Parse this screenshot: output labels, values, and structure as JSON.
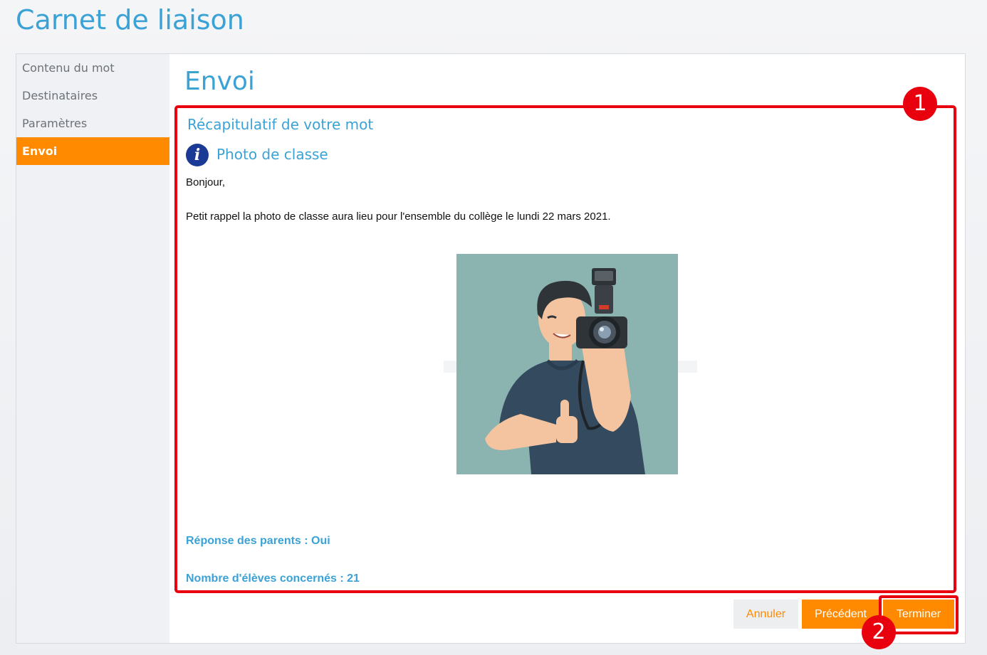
{
  "app": {
    "title": "Carnet de liaison"
  },
  "sidebar": {
    "items": [
      {
        "label": "Contenu du mot",
        "active": false
      },
      {
        "label": "Destinataires",
        "active": false
      },
      {
        "label": "Paramètres",
        "active": false
      },
      {
        "label": "Envoi",
        "active": true
      }
    ]
  },
  "main": {
    "step_title": "Envoi",
    "summary": {
      "title": "Récapitulatif de votre mot",
      "subject_icon": "info-icon",
      "subject": "Photo de classe",
      "greeting": "Bonjour,",
      "body": "Petit rappel la photo de classe aura lieu pour l'ensemble du collège le lundi 22 mars 2021.",
      "image_icon": "photographer-illustration",
      "parents_response": "Réponse des parents : Oui",
      "students_count": "Nombre d'élèves concernés : 21"
    },
    "buttons": {
      "cancel": "Annuler",
      "previous": "Précédent",
      "finish": "Terminer"
    }
  },
  "annotations": {
    "marker_1": "1",
    "marker_2": "2"
  },
  "colors": {
    "accent_blue": "#3ba2d6",
    "accent_orange": "#ff8a00",
    "highlight_red": "#e8000e",
    "info_icon_blue": "#1a3a96",
    "photo_background": "#8bb4b0"
  }
}
